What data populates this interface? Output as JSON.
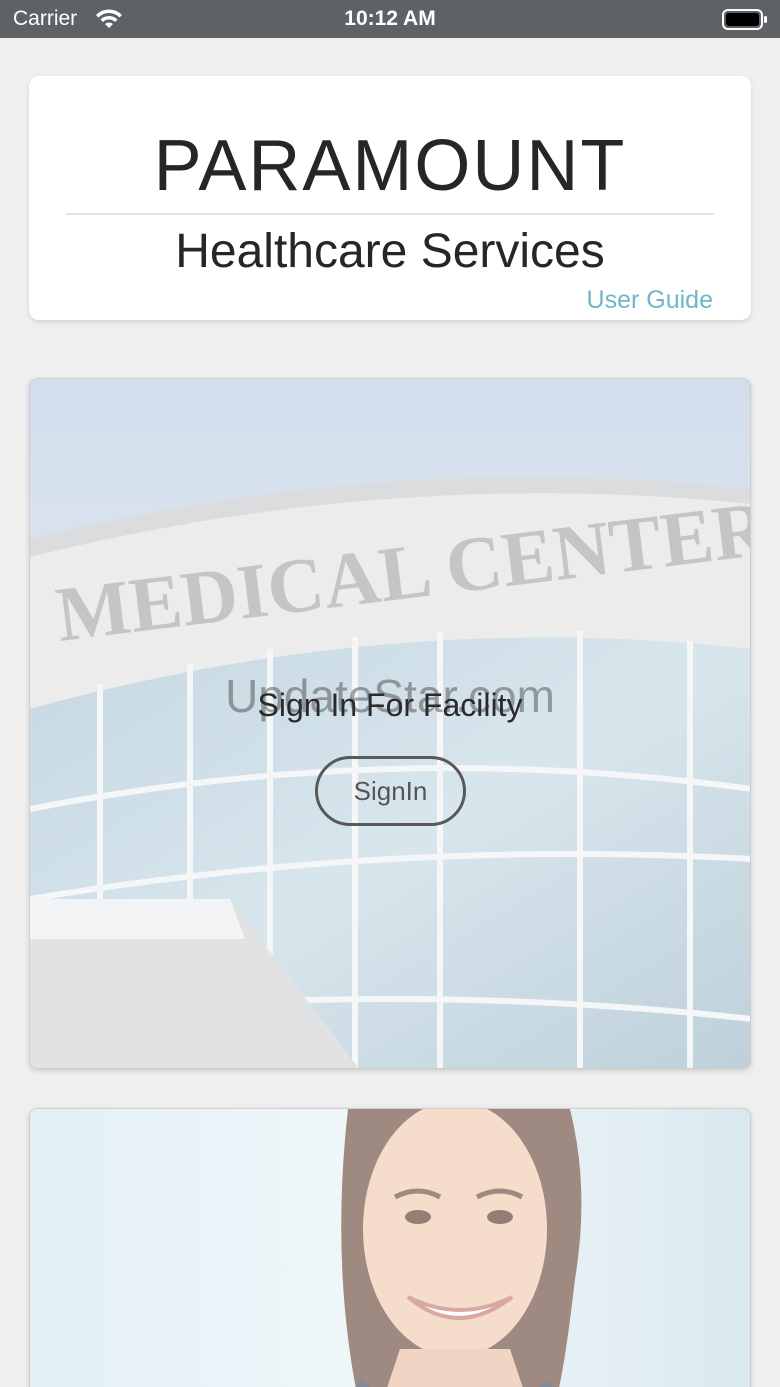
{
  "status_bar": {
    "carrier": "Carrier",
    "time": "10:12 AM",
    "wifi_icon": "wifi-icon",
    "battery_icon": "battery-icon"
  },
  "header": {
    "brand_name": "PARAMOUNT",
    "brand_subtitle": "Healthcare Services",
    "user_guide_label": "User Guide"
  },
  "facility_card": {
    "image": "medical-center-photo",
    "image_sign_text": "MEDICAL CENTER",
    "watermark": "UpdateStar.com",
    "title": "Sign In For Facility",
    "signin_label": "SignIn"
  },
  "doctor_card": {
    "image": "smiling-woman-photo"
  },
  "colors": {
    "background": "#efefef",
    "status_bar": "#5e6165",
    "link": "#6fb6c8",
    "text": "#262626"
  }
}
